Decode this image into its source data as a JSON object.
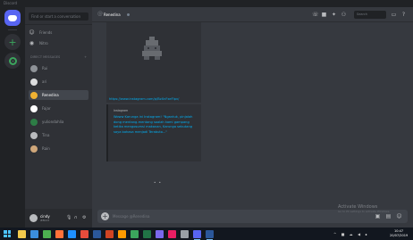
{
  "window": {
    "title": "Discord"
  },
  "search": {
    "placeholder": "Find or start a conversation"
  },
  "nav": [
    {
      "label": "Friends",
      "icon": "friends-icon"
    },
    {
      "label": "Nitro",
      "icon": "nitro-icon"
    }
  ],
  "dm_header": {
    "label": "DIRECT MESSAGES",
    "add": "+"
  },
  "dms": [
    {
      "name": "Rui",
      "avatar_color": "#8e9297",
      "active": false
    },
    {
      "name": "ari",
      "avatar_color": "#dcddde",
      "active": false
    },
    {
      "name": "Renedina",
      "avatar_color": "#f0b232",
      "active": true
    },
    {
      "name": "Fajar",
      "avatar_color": "#ffffff",
      "active": false
    },
    {
      "name": "yuliondahlia",
      "avatar_color": "#2d7d46",
      "active": false
    },
    {
      "name": "Tina",
      "avatar_color": "#b9bbbe",
      "active": false
    },
    {
      "name": "Rain",
      "avatar_color": "#cfa77a",
      "active": false
    }
  ],
  "user": {
    "name": "cindy",
    "tag": "#8023"
  },
  "chat": {
    "channel_name": "Renedina",
    "status_color": "#747f8d"
  },
  "header_search": {
    "placeholder": "Search"
  },
  "messages": {
    "link": "https://www.instagram.com/p/BzXnFxeFlpv/",
    "quote_author": "Instagram",
    "quote_body": "Woww Karunga ini Instagram! \"Ngantuk, pinjalah dong mentang-mentang soalah kami gampang ketika mengosumsi makanan, Karunga sebutang saya bahasa menjadi Terabuto...\"",
    "scroll_indicator": "•  •"
  },
  "composer": {
    "placeholder": "Message @Renedina"
  },
  "watermark": {
    "line1": "Activate Windows",
    "line2": "Go to PC settings to activate Windows."
  },
  "taskbar": {
    "apps": [
      {
        "name": "file-explorer-icon",
        "color": "#f2c94c",
        "running": false
      },
      {
        "name": "store-icon",
        "color": "#3b8ede",
        "running": false
      },
      {
        "name": "chrome-icon",
        "color": "#4caf50",
        "running": false
      },
      {
        "name": "firefox-icon",
        "color": "#ff7139",
        "running": false
      },
      {
        "name": "edge-icon",
        "color": "#1e90ff",
        "running": false
      },
      {
        "name": "app-icon",
        "color": "#e74c3c",
        "running": false
      },
      {
        "name": "word-icon",
        "color": "#2b579a",
        "running": false
      },
      {
        "name": "powerpoint-icon",
        "color": "#d04423",
        "running": false
      },
      {
        "name": "illustrator-icon",
        "color": "#ff9a00",
        "running": false
      },
      {
        "name": "photos-icon",
        "color": "#3ba55d",
        "running": false
      },
      {
        "name": "excel-icon",
        "color": "#217346",
        "running": false
      },
      {
        "name": "media-icon",
        "color": "#7b68ee",
        "running": false
      },
      {
        "name": "paint-icon",
        "color": "#e91e63",
        "running": false
      },
      {
        "name": "settings-icon",
        "color": "#9aa0a6",
        "running": false
      },
      {
        "name": "discord-icon",
        "color": "#5865f2",
        "running": true
      },
      {
        "name": "word-doc-icon",
        "color": "#2b579a",
        "running": true
      }
    ],
    "tray": "^ ■ ☁ ◀ ∎",
    "time": "10:47",
    "date": "20/07/2019"
  }
}
